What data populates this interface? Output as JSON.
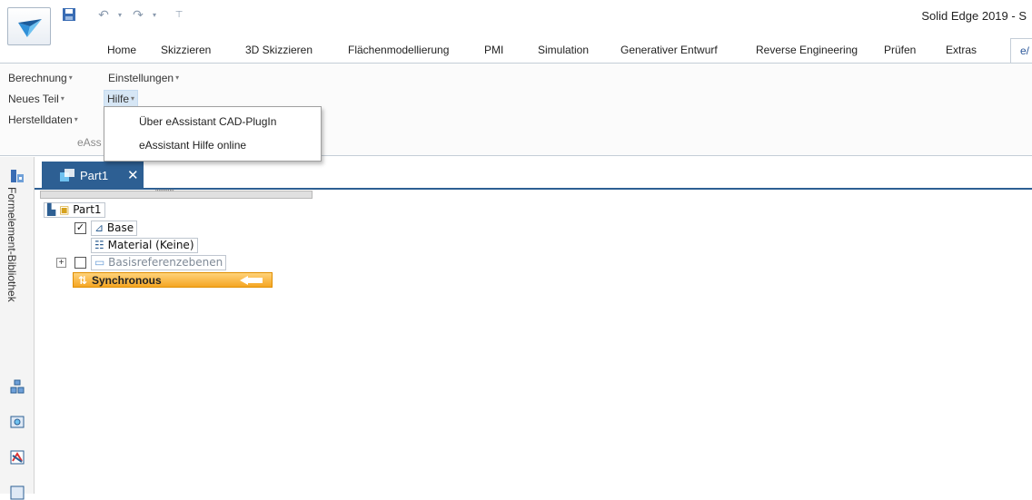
{
  "app": {
    "title": "Solid Edge 2019 - S"
  },
  "quick_access": {
    "save_icon": "save-icon",
    "undo_icon": "undo-icon",
    "redo_icon": "redo-icon",
    "customize_icon": "customize-icon"
  },
  "ribbon_tabs": [
    {
      "label": "Home"
    },
    {
      "label": "Skizzieren"
    },
    {
      "label": "3D Skizzieren"
    },
    {
      "label": "Flächenmodellierung"
    },
    {
      "label": "PMI"
    },
    {
      "label": "Simulation"
    },
    {
      "label": "Generativer Entwurf"
    },
    {
      "label": "Reverse Engineering"
    },
    {
      "label": "Prüfen"
    },
    {
      "label": "Extras"
    },
    {
      "label": "e/"
    }
  ],
  "ribbon": {
    "berechnung": "Berechnung",
    "einstellungen": "Einstellungen",
    "neues_teil": "Neues Teil",
    "hilfe": "Hilfe",
    "herstelldaten": "Herstelldaten",
    "group_label": "eAss",
    "caret": "▾"
  },
  "dropdown": {
    "items": [
      {
        "label": "Über eAssistant CAD-PlugIn"
      },
      {
        "label": "eAssistant Hilfe online"
      }
    ]
  },
  "side_panel": {
    "label": "Formelement-Bibliothek"
  },
  "document_tab": {
    "label": "Part1",
    "close": "✕"
  },
  "pathfinder": {
    "grip": "''''''''''''",
    "root": "Part1",
    "base": "Base",
    "base_checked": "✓",
    "material": "Material (Keine)",
    "reference_planes": "Basisreferenzebenen",
    "expander": "+",
    "synchronous": "Synchronous"
  },
  "colors": {
    "accent_blue": "#2d5f93",
    "active_tab_text": "#2b579a",
    "synchronous_orange": "#f5a623"
  }
}
